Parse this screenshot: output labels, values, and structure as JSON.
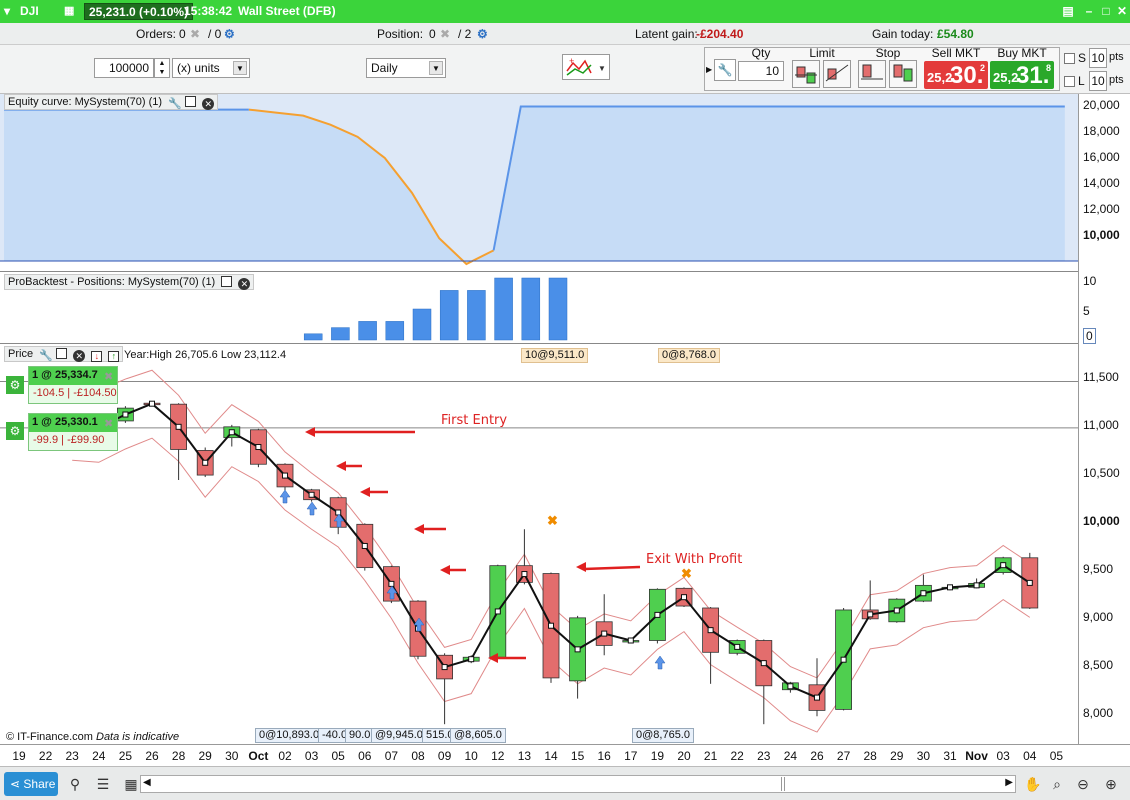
{
  "titlebar": {
    "instrument": "DJI",
    "price": "25,231.0 (+0.10%)",
    "time": "15:38:42",
    "market": "Wall Street (DFB)",
    "dropdown_icon": "chevron-down-icon",
    "grid_icon": "grid-icon"
  },
  "infobar": {
    "orders_label": "Orders:",
    "orders_value": "0",
    "orders_total": "/ 0",
    "position_label": "Position:",
    "position_value": "0",
    "position_total": "/ 2",
    "latent_label": "Latent gain:",
    "latent_value": "-£204.40",
    "gain_today_label": "Gain today:",
    "gain_today_value": "£54.80"
  },
  "controls": {
    "quantity": "100000",
    "units": "(x) units",
    "timeframe": "Daily",
    "qty_label": "Qty",
    "qty_value": "10",
    "limit_label": "Limit",
    "stop_label": "Stop",
    "sell_label": "Sell MKT",
    "sell_small": "25,2",
    "sell_big": "30.",
    "sell_sup": "2",
    "buy_label": "Buy MKT",
    "buy_small": "25,2",
    "buy_big": "31.",
    "buy_sup": "8",
    "s_label": "S",
    "s_value": "10",
    "l_label": "L",
    "l_value": "10",
    "pts": "pts"
  },
  "equity_panel": {
    "title": "Equity curve: MySystem(70) (1)",
    "yticks": [
      "20,000",
      "18,000",
      "16,000",
      "14,000",
      "12,000",
      "10,000"
    ]
  },
  "positions_panel": {
    "title": "ProBacktest - Positions: MySystem(70) (1)",
    "yticks": [
      "10",
      "5",
      "0"
    ]
  },
  "price_panel": {
    "title": "Price",
    "range_text": "Year:High 26,705.6 Low 23,112.4",
    "yticks": [
      "11,500",
      "11,000",
      "10,500",
      "10,000",
      "9,500",
      "9,000",
      "8,500",
      "8,000"
    ],
    "top_tags": [
      "10@9,511.0",
      "0@8,768.0"
    ],
    "bottom_tags": [
      "0@10,893.0",
      "-40.0",
      "90.0",
      "@9,945.0",
      "515.0",
      "@8,605.0",
      "0@8,765.0"
    ],
    "position1": {
      "label": "1 @ 25,334.7",
      "pts": "-104.5",
      "gain": "-£104.50"
    },
    "position2": {
      "label": "1 @ 25,330.1",
      "pts": "-99.9",
      "gain": "-£99.90"
    },
    "annotation_first": "First Entry",
    "annotation_exit": "Exit With Profit",
    "copyright": "© IT-Finance.com",
    "disclaimer": "Data is indicative"
  },
  "xaxis": {
    "labels": [
      "19",
      "22",
      "23",
      "24",
      "25",
      "26",
      "28",
      "29",
      "30",
      "Oct",
      "02",
      "03",
      "05",
      "06",
      "07",
      "08",
      "09",
      "10",
      "12",
      "13",
      "14",
      "15",
      "16",
      "17",
      "19",
      "20",
      "21",
      "22",
      "23",
      "24",
      "26",
      "27",
      "28",
      "29",
      "30",
      "31",
      "Nov",
      "03",
      "04",
      "05"
    ]
  },
  "bottombar": {
    "share_label": "Share"
  },
  "chart_data": {
    "type": "candlestick",
    "price_ylim": [
      7800,
      11700
    ],
    "candles": [
      {
        "o": 10950,
        "c": 10950,
        "h": 11050,
        "l": 10850
      },
      {
        "o": 10880,
        "c": 10980,
        "h": 11020,
        "l": 10820
      },
      {
        "o": 11000,
        "c": 11130,
        "h": 11150,
        "l": 10980
      },
      {
        "o": 11180,
        "c": 11170,
        "h": 11190,
        "l": 11160
      },
      {
        "o": 11170,
        "c": 10710,
        "h": 11180,
        "l": 10400
      },
      {
        "o": 10700,
        "c": 10450,
        "h": 10730,
        "l": 10430
      },
      {
        "o": 10830,
        "c": 10940,
        "h": 10960,
        "l": 10740
      },
      {
        "o": 10910,
        "c": 10560,
        "h": 10920,
        "l": 10530
      },
      {
        "o": 10560,
        "c": 10330,
        "h": 10570,
        "l": 10290
      },
      {
        "o": 10300,
        "c": 10200,
        "h": 10310,
        "l": 10180
      },
      {
        "o": 10220,
        "c": 9920,
        "h": 10230,
        "l": 9850
      },
      {
        "o": 9950,
        "c": 9510,
        "h": 9960,
        "l": 9480
      },
      {
        "o": 9520,
        "c": 9170,
        "h": 9530,
        "l": 9150
      },
      {
        "o": 9170,
        "c": 8610,
        "h": 9180,
        "l": 8580
      },
      {
        "o": 8620,
        "c": 8380,
        "h": 8640,
        "l": 7920
      },
      {
        "o": 8560,
        "c": 8600,
        "h": 8620,
        "l": 8540
      },
      {
        "o": 8600,
        "c": 9530,
        "h": 9540,
        "l": 8590
      },
      {
        "o": 9530,
        "c": 9360,
        "h": 9900,
        "l": 9340
      },
      {
        "o": 9450,
        "c": 8390,
        "h": 9460,
        "l": 8340
      },
      {
        "o": 8360,
        "c": 9000,
        "h": 9020,
        "l": 8180
      },
      {
        "o": 8960,
        "c": 8720,
        "h": 9240,
        "l": 8620
      },
      {
        "o": 8770,
        "c": 8770,
        "h": 8790,
        "l": 8740
      },
      {
        "o": 8770,
        "c": 9290,
        "h": 9300,
        "l": 8740
      },
      {
        "o": 9300,
        "c": 9120,
        "h": 9310,
        "l": 9110
      },
      {
        "o": 9100,
        "c": 8650,
        "h": 9110,
        "l": 8330
      },
      {
        "o": 8640,
        "c": 8770,
        "h": 8780,
        "l": 8620
      },
      {
        "o": 8770,
        "c": 8310,
        "h": 8780,
        "l": 7920
      },
      {
        "o": 8270,
        "c": 8340,
        "h": 8350,
        "l": 8240
      },
      {
        "o": 8320,
        "c": 8060,
        "h": 8590,
        "l": 8000
      },
      {
        "o": 8070,
        "c": 9080,
        "h": 9100,
        "l": 8060
      },
      {
        "o": 9080,
        "c": 8990,
        "h": 9380,
        "l": 8980
      },
      {
        "o": 8960,
        "c": 9190,
        "h": 9200,
        "l": 8950
      },
      {
        "o": 9170,
        "c": 9330,
        "h": 9440,
        "l": 9160
      },
      {
        "o": 9310,
        "c": 9310,
        "h": 9330,
        "l": 9280
      },
      {
        "o": 9310,
        "c": 9350,
        "h": 9400,
        "l": 9300
      },
      {
        "o": 9460,
        "c": 9610,
        "h": 9620,
        "l": 9440
      },
      {
        "o": 9610,
        "c": 9100,
        "h": 9660,
        "l": 9090
      }
    ],
    "equity_ylim": [
      9800,
      20500
    ],
    "equity_values": [
      20000,
      20000,
      20000,
      20000,
      20000,
      20000,
      20000,
      20000,
      20000,
      20000,
      19800,
      19600,
      19000,
      18200,
      16800,
      14500,
      11500,
      9800,
      10700,
      20200,
      20200,
      20200,
      20200,
      20200,
      20200,
      20200,
      20200,
      20200,
      20200,
      20200,
      20200,
      20200,
      20200,
      20200,
      20200,
      20200,
      20200,
      20200,
      20200,
      20200
    ],
    "positions_ylim": [
      0,
      10
    ],
    "position_bars": [
      0,
      0,
      0,
      0,
      0,
      0,
      0,
      0,
      0,
      0,
      0,
      1,
      2,
      3,
      3,
      5,
      8,
      8,
      10,
      10,
      10,
      0,
      0,
      0,
      0,
      0,
      0,
      0,
      0,
      0,
      0,
      0,
      0,
      0,
      0,
      0,
      0,
      0,
      0,
      0
    ]
  },
  "colors": {
    "titlebar_green": "#3bd43b",
    "candle_up": "#4fcf4f",
    "candle_down": "#e36d6d",
    "equity_fill": "#c6dcf6",
    "equity_line": "#5b94e8",
    "equity_down": "#f5a030",
    "position_bar": "#4a8fe8",
    "arrow_red": "#e02020",
    "envelope": "#e08a8a"
  }
}
